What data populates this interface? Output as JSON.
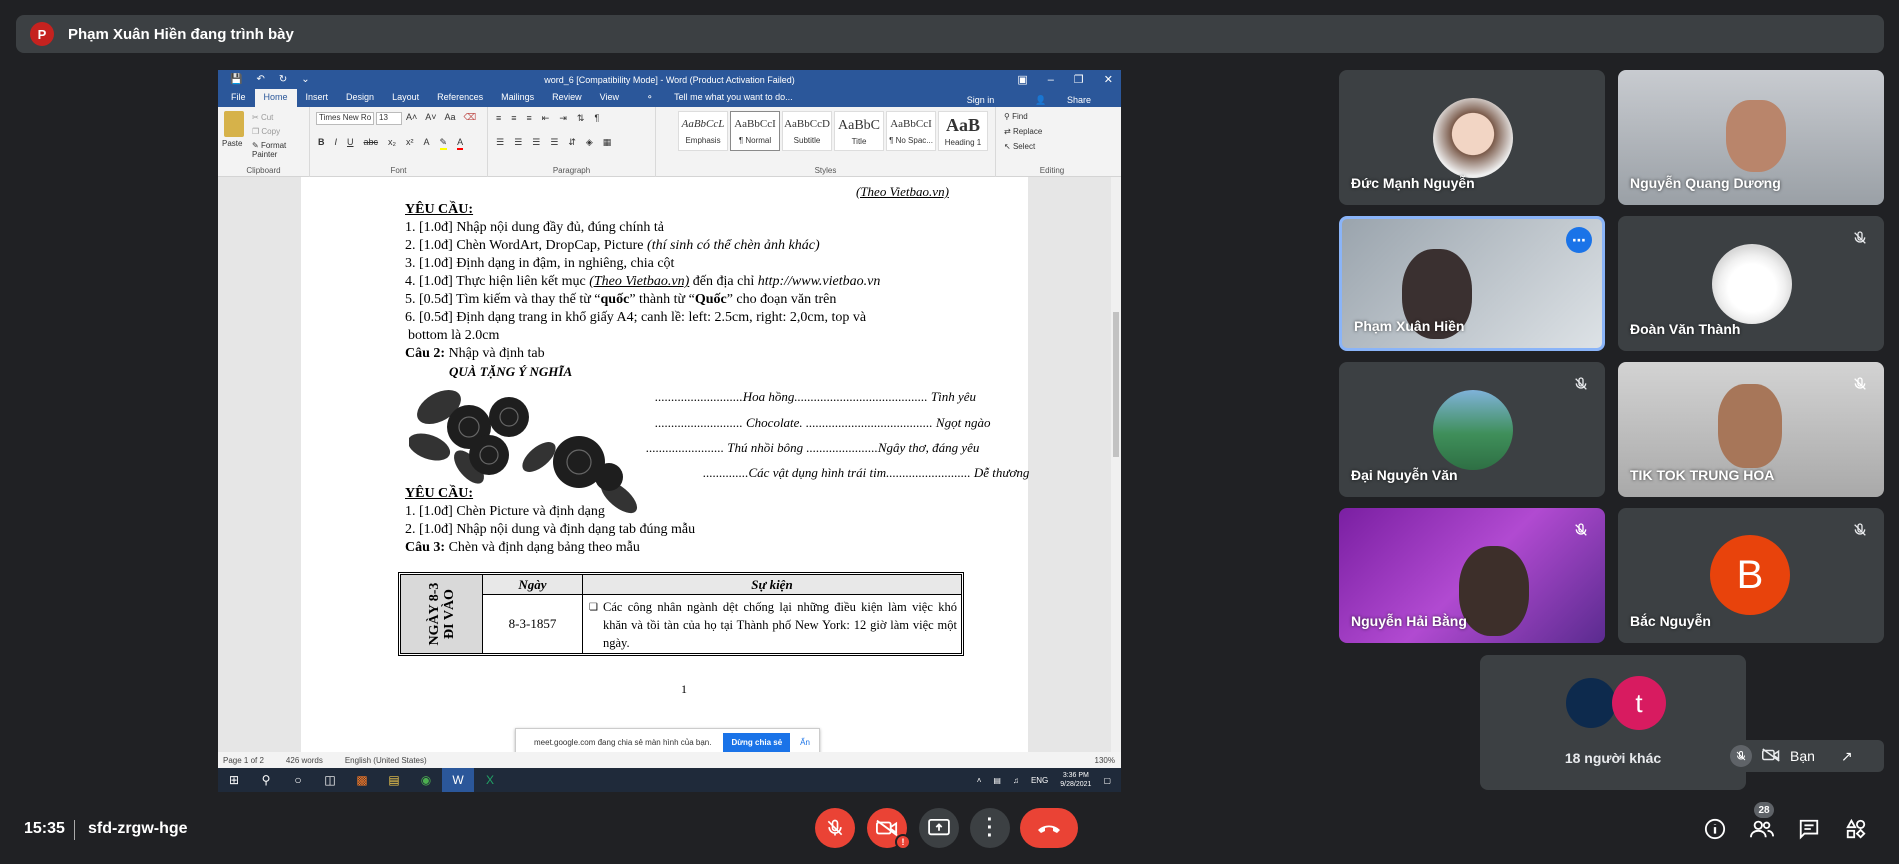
{
  "presenter": {
    "initial": "P",
    "text": "Phạm Xuân Hiền đang trình bày"
  },
  "word": {
    "title": "word_6 [Compatibility Mode] - Word (Product Activation Failed)",
    "tabs": [
      "File",
      "Home",
      "Insert",
      "Design",
      "Layout",
      "References",
      "Mailings",
      "Review",
      "View"
    ],
    "tell_me": "Tell me what you want to do...",
    "sign_in": "Sign in",
    "share": "Share",
    "ribbon": {
      "clipboard": {
        "paste": "Paste",
        "cut": "Cut",
        "copy": "Copy",
        "format_painter": "Format Painter",
        "name": "Clipboard"
      },
      "font": {
        "family": "Times New Ro",
        "size": "13",
        "name": "Font"
      },
      "paragraph": {
        "name": "Paragraph"
      },
      "styles": {
        "name": "Styles",
        "items": [
          {
            "preview": "AaBbCcL",
            "label": "Emphasis"
          },
          {
            "preview": "AaBbCcI",
            "label": "¶ Normal"
          },
          {
            "preview": "AaBbCcD",
            "label": "Subtitle"
          },
          {
            "preview": "AaBbC",
            "label": "Title"
          },
          {
            "preview": "AaBbCcI",
            "label": "¶ No Spac..."
          },
          {
            "preview": "AaB",
            "label": "Heading 1"
          }
        ]
      },
      "editing": {
        "find": "Find",
        "replace": "Replace",
        "select": "Select",
        "name": "Editing"
      }
    },
    "doc": {
      "source": "(Theo Vietbao.vn)",
      "req1": "YÊU CẦU:",
      "r1": "1. [1.0đ] Nhập nội dung đầy đủ, đúng chính tả",
      "r2a": "2. [1.0đ] Chèn WordArt, DropCap, Picture ",
      "r2b": "(thí sinh có thể chèn ảnh khác)",
      "r3": "3. [1.0đ] Định dạng in đậm, in nghiêng, chia cột",
      "r4a": "4. [1.0đ] Thực hiện liên kết mục ",
      "r4b": "(Theo Vietbao.vn)",
      "r4c": " đến địa chỉ ",
      "r4d": "http://www.vietbao.vn",
      "r5a": "5. [0.5đ] Tìm kiếm và thay thế từ “",
      "r5b": "quốc",
      "r5c": "” thành từ “",
      "r5d": "Quốc",
      "r5e": "” cho đoạn văn trên",
      "r6a": "6. [0.5đ] Định dạng trang in khổ giấy A4; canh lề: left: 2.5cm, right: 2,0cm, top và",
      "r6b": "bottom là 2.0cm",
      "c2a": "Câu 2:",
      "c2b": " Nhập và định tab",
      "gift_title": "QUÀ TẶNG Ý NGHĨA",
      "tab1": "...........................Hoa hồng.........................................  Tình yêu",
      "tab2": "........................... Chocolate. .......................................  Ngọt ngào",
      "tab3": "........................ Thú nhồi bông ......................Ngây thơ, đáng yêu",
      "tab4": "..............Các vật dụng hình trái tim..........................  Dễ thương",
      "req2": "YÊU CẦU:",
      "q1": "1.   [1.0đ]  Chèn Picture và định dạng",
      "q2": "2.   [1.0đ]  Nhập nội dung và định dạng tab đúng mẫu",
      "c3a": "Câu 3:",
      "c3b": " Chèn và định dạng bảng theo mẫu",
      "table": {
        "vertical": "NGÀY 8-3 ĐI VÀO",
        "h_date": "Ngày",
        "h_event": "Sự kiện",
        "date": "8-3-1857",
        "event": "Các công nhân ngành dệt chống lại những điều kiện làm việc khó khăn và tồi tàn của họ tại Thành phố New York: 12 giờ làm việc một ngày."
      },
      "page_number": "1"
    },
    "share_notice": {
      "text": "meet.google.com đang chia sẻ màn hình của bạn.",
      "stop": "Dừng chia sẻ",
      "hide": "Ẩn"
    },
    "status": {
      "page": "Page 1 of 2",
      "words": "426 words",
      "lang": "English (United States)",
      "zoom": "130%"
    },
    "taskbar": {
      "lang": "ENG",
      "time": "3:36 PM",
      "date": "9/28/2021"
    }
  },
  "participants": [
    {
      "name": "Đức Mạnh Nguyễn",
      "muted": false
    },
    {
      "name": "Nguyễn Quang Dương",
      "muted": false
    },
    {
      "name": "Phạm Xuân Hiền",
      "muted": false
    },
    {
      "name": "Đoàn Văn Thành",
      "muted": true
    },
    {
      "name": "Đại Nguyễn Văn",
      "muted": true
    },
    {
      "name": "TIK TOK TRUNG HOA",
      "muted": true
    },
    {
      "name": "Nguyễn Hải Bằng",
      "muted": true
    },
    {
      "name": "Bắc Nguyễn",
      "initial": "B",
      "muted": true
    }
  ],
  "others": {
    "initial": "t",
    "label": "18 người khác"
  },
  "self_view": {
    "label": "Bạn"
  },
  "meeting": {
    "time": "15:35",
    "code": "sfd-zrgw-hge",
    "participant_count": "28"
  },
  "colors": {
    "bg": "#202124",
    "tile": "#3c4043",
    "red": "#ea4335",
    "word_blue": "#2b579a",
    "meet_blue": "#1a73e8"
  }
}
